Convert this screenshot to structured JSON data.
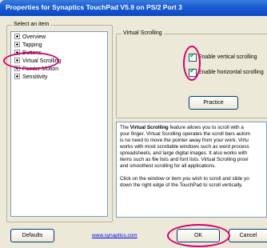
{
  "window": {
    "title": "Properties for Synaptics TouchPad V5.9 on PS/2 Port 3"
  },
  "left_panel": {
    "legend": "Select an item",
    "items": [
      {
        "label": "Overview"
      },
      {
        "label": "Tapping"
      },
      {
        "label": "Buttons"
      },
      {
        "label": "Virtual Scrolling"
      },
      {
        "label": "Pointer Motion"
      },
      {
        "label": "Sensitivity"
      }
    ],
    "selected": "Virtual Scrolling"
  },
  "right_panel": {
    "legend": "Virtual Scrolling",
    "options": [
      {
        "label": "Enable vertical scrolling",
        "checked": true
      },
      {
        "label": "Enable horizontal scrolling",
        "checked": true
      }
    ],
    "practice_label": "Practice"
  },
  "description": {
    "line1_pre": "The ",
    "line1_bold": "Virtual Scrolling",
    "line1_post": " feature allows you to scroll with a",
    "lines": [
      "your finger. Virtual Scrolling operates the scroll bars autom",
      "is no need to move the pointer away from your work. Virtu",
      "works with most scrollable windows such as word process",
      "spreadsheets, and large digital images. It also works with",
      "items such as file lists and font lists. Virtual Scrolling provi",
      "and smoothest scrolling for all applications."
    ],
    "para2": [
      "Click on the window or item you wish to scroll and slide yo",
      "down the right edge of the TouchPad to scroll vertically."
    ]
  },
  "footer": {
    "defaults_label": "Defaults",
    "link_text": "www.synaptics.com",
    "ok_label": "OK",
    "cancel_label": "Cancel"
  },
  "colors": {
    "titlebar": "#0b47c4",
    "annotation": "#d4006e",
    "checkmark": "#21a121"
  }
}
